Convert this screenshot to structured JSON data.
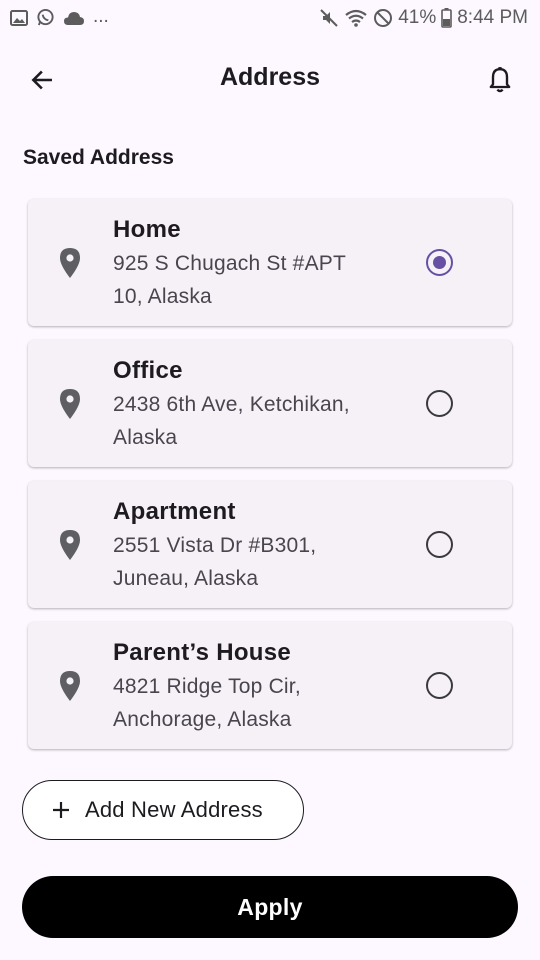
{
  "status_bar": {
    "more": "...",
    "battery": "41%",
    "time": "8:44 PM"
  },
  "header": {
    "title": "Address",
    "back_icon": "arrow-left-icon",
    "notification_icon": "bell-icon"
  },
  "section": {
    "title": "Saved Address"
  },
  "addresses": [
    {
      "name": "Home",
      "line1": "925 S Chugach St #APT",
      "line2": "10, Alaska",
      "selected": true
    },
    {
      "name": "Office",
      "line1": "2438 6th Ave, Ketchikan,",
      "line2": "Alaska",
      "selected": false
    },
    {
      "name": "Apartment",
      "line1": "2551 Vista Dr #B301,",
      "line2": "Juneau, Alaska",
      "selected": false
    },
    {
      "name": "Parent’s House",
      "line1": "4821 Ridge Top Cir,",
      "line2": "Anchorage, Alaska",
      "selected": false
    }
  ],
  "add_button": {
    "label": "Add New Address"
  },
  "apply_button": {
    "label": "Apply"
  },
  "colors": {
    "background": "#fdf7ff",
    "card": "#f6f1f7",
    "accent": "#6750a4",
    "primary_button": "#000000"
  }
}
